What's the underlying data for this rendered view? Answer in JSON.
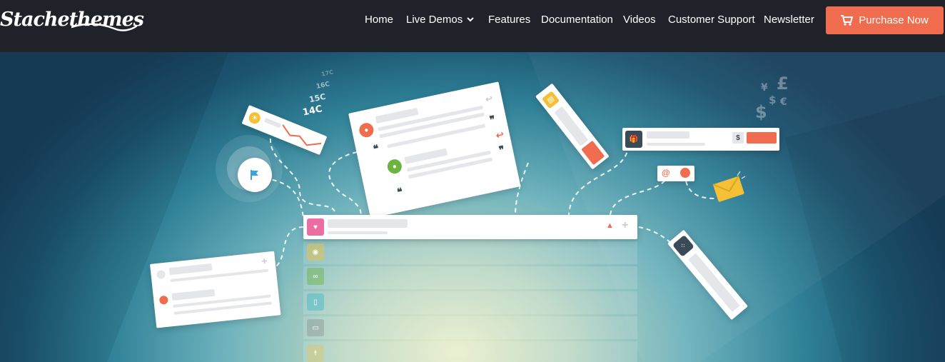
{
  "brand": {
    "name": "Stachethemes"
  },
  "nav": {
    "items": [
      {
        "label": "Home"
      },
      {
        "label": "Live Demos"
      },
      {
        "label": "Features"
      },
      {
        "label": "Documentation"
      },
      {
        "label": "Videos"
      },
      {
        "label": "Customer Support"
      },
      {
        "label": "Newsletter"
      }
    ],
    "purchase_label": "Purchase Now"
  },
  "hero": {
    "weather_card": {
      "temps": [
        "17C",
        "16C",
        "15C",
        "14C"
      ]
    },
    "currency_symbols": [
      "¥",
      "£",
      "$",
      "€",
      "$"
    ],
    "icons": [
      "flag-icon",
      "heart-icon",
      "camera-icon",
      "bike-icon",
      "mug-icon",
      "bus-icon",
      "bell-icon",
      "plus-icon",
      "gift-icon",
      "cart-icon",
      "envelope-icon",
      "at-icon",
      "clock-icon",
      "user-icon",
      "quote-icon",
      "reply-icon",
      "ticket-icon",
      "sun-icon"
    ]
  },
  "colors": {
    "nav_bg": "#1f2228",
    "accent": "#f06c4e",
    "pink": "#ea6fa0",
    "green": "#6cb33f",
    "teal": "#3fb7c8",
    "yellow": "#f4c136"
  }
}
